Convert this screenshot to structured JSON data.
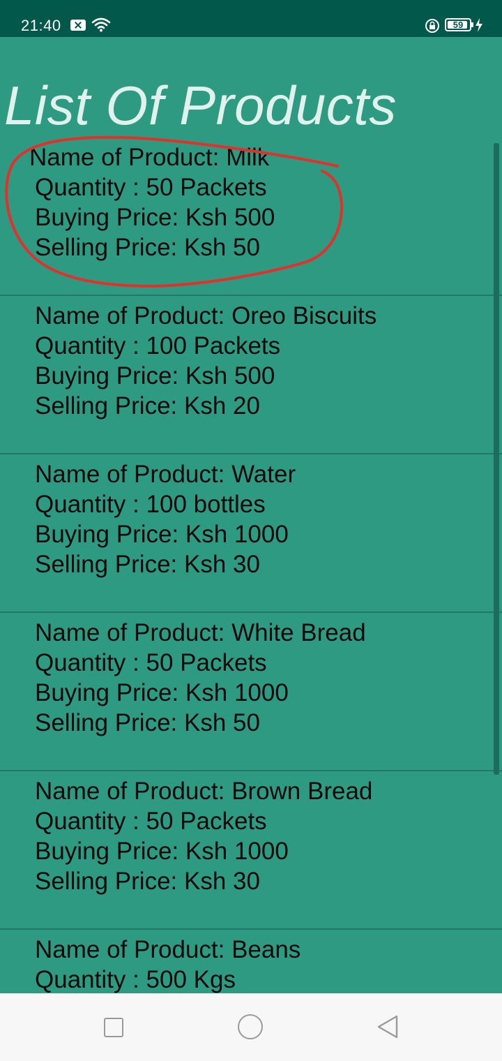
{
  "status_bar": {
    "time": "21:40",
    "battery": "59"
  },
  "page": {
    "title": "List Of Products"
  },
  "products": [
    {
      "name": "Name of Product: Milk",
      "quantity": "Quantity : 50 Packets",
      "buying": "Buying Price: Ksh 500",
      "selling": "Selling Price: Ksh 50"
    },
    {
      "name": "Name of Product: Oreo Biscuits",
      "quantity": "Quantity : 100 Packets",
      "buying": "Buying Price: Ksh 500",
      "selling": "Selling Price: Ksh 20"
    },
    {
      "name": "Name of Product: Water",
      "quantity": "Quantity : 100 bottles",
      "buying": "Buying Price: Ksh 1000",
      "selling": "Selling Price: Ksh 30"
    },
    {
      "name": "Name of Product: White Bread",
      "quantity": "Quantity : 50 Packets",
      "buying": "Buying Price: Ksh 1000",
      "selling": "Selling Price: Ksh 50"
    },
    {
      "name": "Name of Product: Brown Bread",
      "quantity": "Quantity : 50 Packets",
      "buying": "Buying Price: Ksh 1000",
      "selling": "Selling Price: Ksh 30"
    },
    {
      "name": "Name of Product: Beans",
      "quantity": "Quantity : 500 Kgs",
      "buying": "",
      "selling": ""
    }
  ],
  "colors": {
    "background": "#2e9a82",
    "status_bar": "#02584a",
    "title": "#e0f2ee",
    "annotation": "#e0322c"
  },
  "icons": {
    "notification": "close-box-icon",
    "wifi": "wifi-icon",
    "lock": "rotation-lock-icon",
    "charging": "bolt-icon",
    "nav": [
      "square-recent-icon",
      "circle-home-icon",
      "triangle-back-icon"
    ]
  }
}
